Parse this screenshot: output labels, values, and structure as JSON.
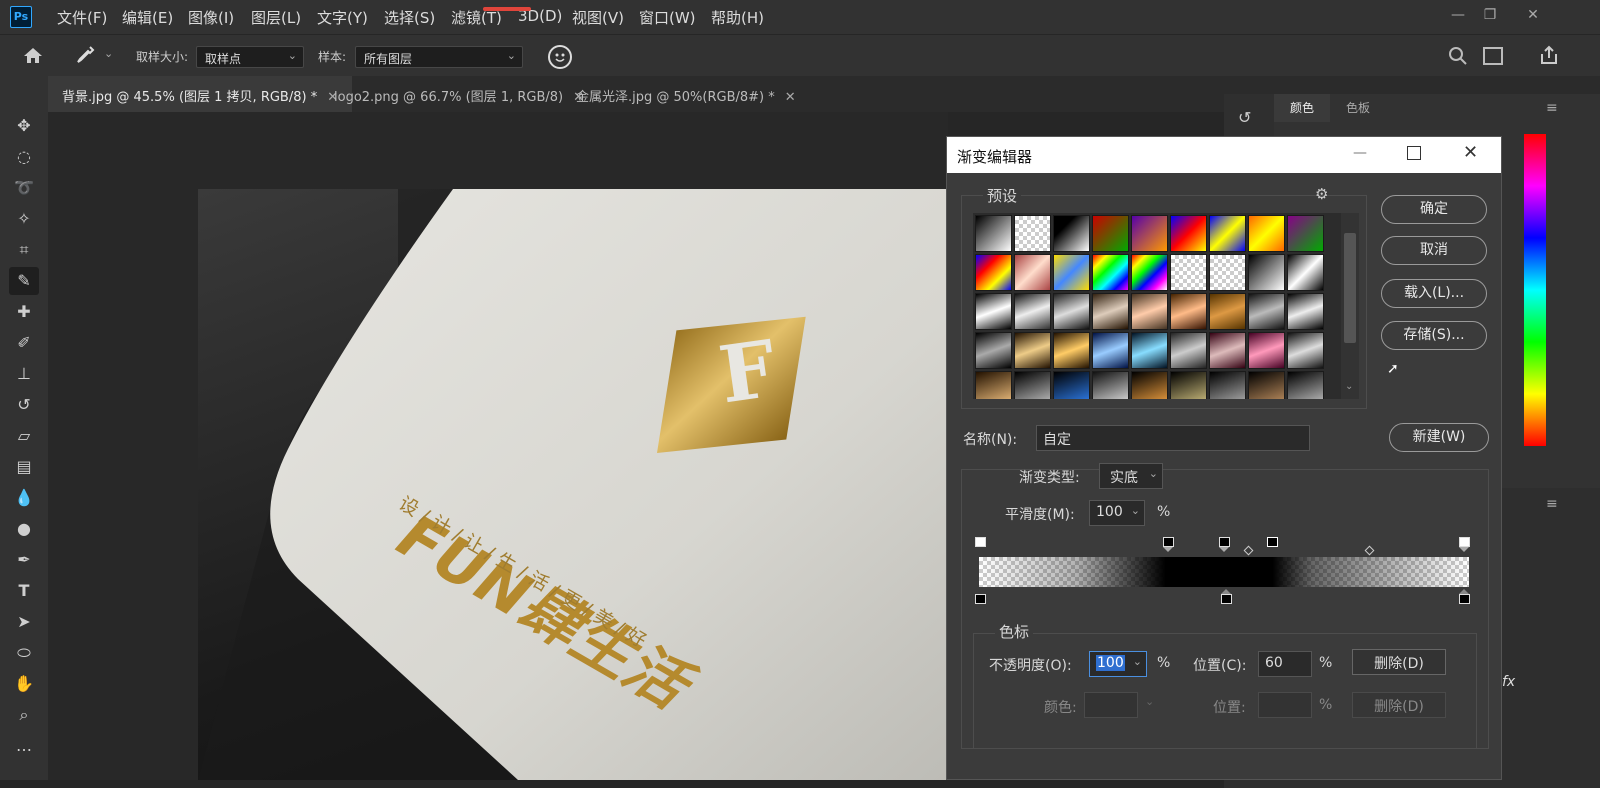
{
  "app": {
    "logo": "Ps"
  },
  "menu": [
    "文件(F)",
    "编辑(E)",
    "图像(I)",
    "图层(L)",
    "文字(Y)",
    "选择(S)",
    "滤镜(T)",
    "3D(D)",
    "视图(V)",
    "窗口(W)",
    "帮助(H)"
  ],
  "window_controls": {
    "minimize": "—",
    "restore": "❐",
    "close": "✕"
  },
  "options": {
    "sample_size_label": "取样大小:",
    "sample_size_value": "取样点",
    "sample_label": "样本:",
    "sample_value": "所有图层"
  },
  "tabs": [
    {
      "label": "背景.jpg @ 45.5% (图层 1 拷贝, RGB/8) *",
      "close": "✕"
    },
    {
      "label": "logo2.png @ 66.7% (图层 1, RGB/8)",
      "close": "✕"
    },
    {
      "label": "金属光泽.jpg @ 50%(RGB/8#) *",
      "close": "✕"
    }
  ],
  "canvas": {
    "brand_main": "FUN肆生活",
    "slogan": "设 / 计 / 让 / 生 / 活 / 更 / 美 / 好",
    "logo_letter": "F"
  },
  "right_panel": {
    "tab_color": "颜色",
    "tab_swatches": "色板"
  },
  "dialog": {
    "title": "渐变编辑器",
    "presets_label": "预设",
    "buttons": {
      "ok": "确定",
      "cancel": "取消",
      "load": "载入(L)...",
      "save": "存储(S)...",
      "new": "新建(W)"
    },
    "name_label": "名称(N):",
    "name_value": "自定",
    "gradient_type_label": "渐变类型:",
    "gradient_type_value": "实底",
    "smoothness_label": "平滑度(M):",
    "smoothness_value": "100",
    "percent": "%",
    "stops_group_label": "色标",
    "opacity_label": "不透明度(O):",
    "opacity_value": "100",
    "location_label": "位置(C):",
    "location_value": "60",
    "delete_label": "删除(D)",
    "color_label": "颜色:",
    "color_location_label": "位置:",
    "color_delete_label": "删除(D)"
  }
}
